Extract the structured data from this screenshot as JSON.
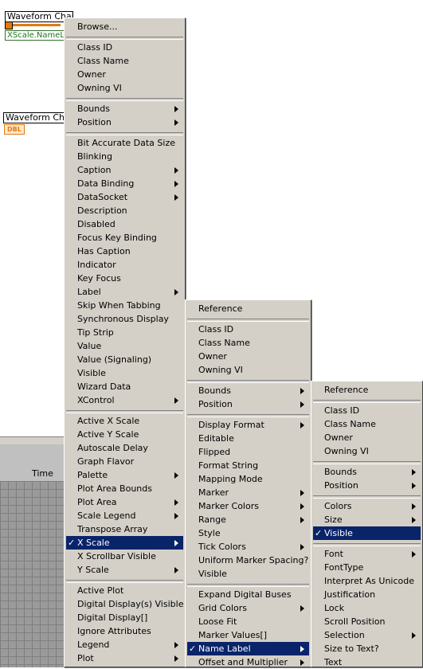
{
  "diagram": {
    "top_node_label": "Waveform Chart",
    "property_label": "XScale.NameLabel",
    "ref_icon": "refnum-icon",
    "bottom_node_label": "Waveform Chart",
    "dbl_terminal": "DBL",
    "time_axis_label": "Time"
  },
  "menu1": {
    "items": [
      {
        "label": "Browse...",
        "sub": false
      },
      {
        "sep": true
      },
      {
        "label": "Class ID",
        "sub": false
      },
      {
        "label": "Class Name",
        "sub": false
      },
      {
        "label": "Owner",
        "sub": false
      },
      {
        "label": "Owning VI",
        "sub": false
      },
      {
        "sep": true
      },
      {
        "label": "Bounds",
        "sub": true
      },
      {
        "label": "Position",
        "sub": true
      },
      {
        "sep": true
      },
      {
        "label": "Bit Accurate Data Size",
        "sub": false
      },
      {
        "label": "Blinking",
        "sub": false
      },
      {
        "label": "Caption",
        "sub": true
      },
      {
        "label": "Data Binding",
        "sub": true
      },
      {
        "label": "DataSocket",
        "sub": true
      },
      {
        "label": "Description",
        "sub": false
      },
      {
        "label": "Disabled",
        "sub": false
      },
      {
        "label": "Focus Key Binding",
        "sub": false
      },
      {
        "label": "Has Caption",
        "sub": false
      },
      {
        "label": "Indicator",
        "sub": false
      },
      {
        "label": "Key Focus",
        "sub": false
      },
      {
        "label": "Label",
        "sub": true
      },
      {
        "label": "Skip When Tabbing",
        "sub": false
      },
      {
        "label": "Synchronous Display",
        "sub": false
      },
      {
        "label": "Tip Strip",
        "sub": false
      },
      {
        "label": "Value",
        "sub": false
      },
      {
        "label": "Value (Signaling)",
        "sub": false
      },
      {
        "label": "Visible",
        "sub": false
      },
      {
        "label": "Wizard Data",
        "sub": false
      },
      {
        "label": "XControl",
        "sub": true
      },
      {
        "sep": true
      },
      {
        "label": "Active X Scale",
        "sub": false
      },
      {
        "label": "Active Y Scale",
        "sub": false
      },
      {
        "label": "Autoscale Delay",
        "sub": false
      },
      {
        "label": "Graph Flavor",
        "sub": false
      },
      {
        "label": "Palette",
        "sub": true
      },
      {
        "label": "Plot Area Bounds",
        "sub": false
      },
      {
        "label": "Plot Area",
        "sub": true
      },
      {
        "label": "Scale Legend",
        "sub": true
      },
      {
        "label": "Transpose Array",
        "sub": false
      },
      {
        "label": "X Scale",
        "sub": true,
        "selected": true,
        "checked": true
      },
      {
        "label": "X Scrollbar Visible",
        "sub": false
      },
      {
        "label": "Y Scale",
        "sub": true
      },
      {
        "sep": true
      },
      {
        "label": "Active Plot",
        "sub": false
      },
      {
        "label": "Digital Display(s) Visible",
        "sub": false
      },
      {
        "label": "Digital Display[]",
        "sub": false
      },
      {
        "label": "Ignore Attributes",
        "sub": false
      },
      {
        "label": "Legend",
        "sub": true
      },
      {
        "label": "Plot",
        "sub": true
      }
    ]
  },
  "menu2": {
    "items": [
      {
        "label": "Reference",
        "sub": false
      },
      {
        "sep": true
      },
      {
        "label": "Class ID",
        "sub": false
      },
      {
        "label": "Class Name",
        "sub": false
      },
      {
        "label": "Owner",
        "sub": false
      },
      {
        "label": "Owning VI",
        "sub": false
      },
      {
        "sep": true
      },
      {
        "label": "Bounds",
        "sub": true
      },
      {
        "label": "Position",
        "sub": true
      },
      {
        "sep": true
      },
      {
        "label": "Display Format",
        "sub": true
      },
      {
        "label": "Editable",
        "sub": false
      },
      {
        "label": "Flipped",
        "sub": false
      },
      {
        "label": "Format String",
        "sub": false
      },
      {
        "label": "Mapping Mode",
        "sub": false
      },
      {
        "label": "Marker",
        "sub": true
      },
      {
        "label": "Marker Colors",
        "sub": true
      },
      {
        "label": "Range",
        "sub": true
      },
      {
        "label": "Style",
        "sub": false
      },
      {
        "label": "Tick Colors",
        "sub": true
      },
      {
        "label": "Uniform Marker Spacing?",
        "sub": false
      },
      {
        "label": "Visible",
        "sub": false
      },
      {
        "sep": true
      },
      {
        "label": "Expand Digital Buses",
        "sub": false
      },
      {
        "label": "Grid Colors",
        "sub": true
      },
      {
        "label": "Loose Fit",
        "sub": false
      },
      {
        "label": "Marker Values[]",
        "sub": false
      },
      {
        "label": "Name Label",
        "sub": true,
        "selected": true,
        "checked": true
      },
      {
        "label": "Offset and Multiplier",
        "sub": true
      }
    ]
  },
  "menu3": {
    "items": [
      {
        "label": "Reference",
        "sub": false
      },
      {
        "sep": true
      },
      {
        "label": "Class ID",
        "sub": false
      },
      {
        "label": "Class Name",
        "sub": false
      },
      {
        "label": "Owner",
        "sub": false
      },
      {
        "label": "Owning VI",
        "sub": false
      },
      {
        "sep": true
      },
      {
        "label": "Bounds",
        "sub": true
      },
      {
        "label": "Position",
        "sub": true
      },
      {
        "sep": true
      },
      {
        "label": "Colors",
        "sub": true
      },
      {
        "label": "Size",
        "sub": true
      },
      {
        "label": "Visible",
        "sub": false,
        "selected": true,
        "checked": true
      },
      {
        "sep": true
      },
      {
        "label": "Font",
        "sub": true
      },
      {
        "label": "FontType",
        "sub": false
      },
      {
        "label": "Interpret As Unicode",
        "sub": false
      },
      {
        "label": "Justification",
        "sub": false
      },
      {
        "label": "Lock",
        "sub": false
      },
      {
        "label": "Scroll Position",
        "sub": false
      },
      {
        "label": "Selection",
        "sub": true
      },
      {
        "label": "Size to Text?",
        "sub": false
      },
      {
        "label": "Text",
        "sub": false
      }
    ]
  }
}
